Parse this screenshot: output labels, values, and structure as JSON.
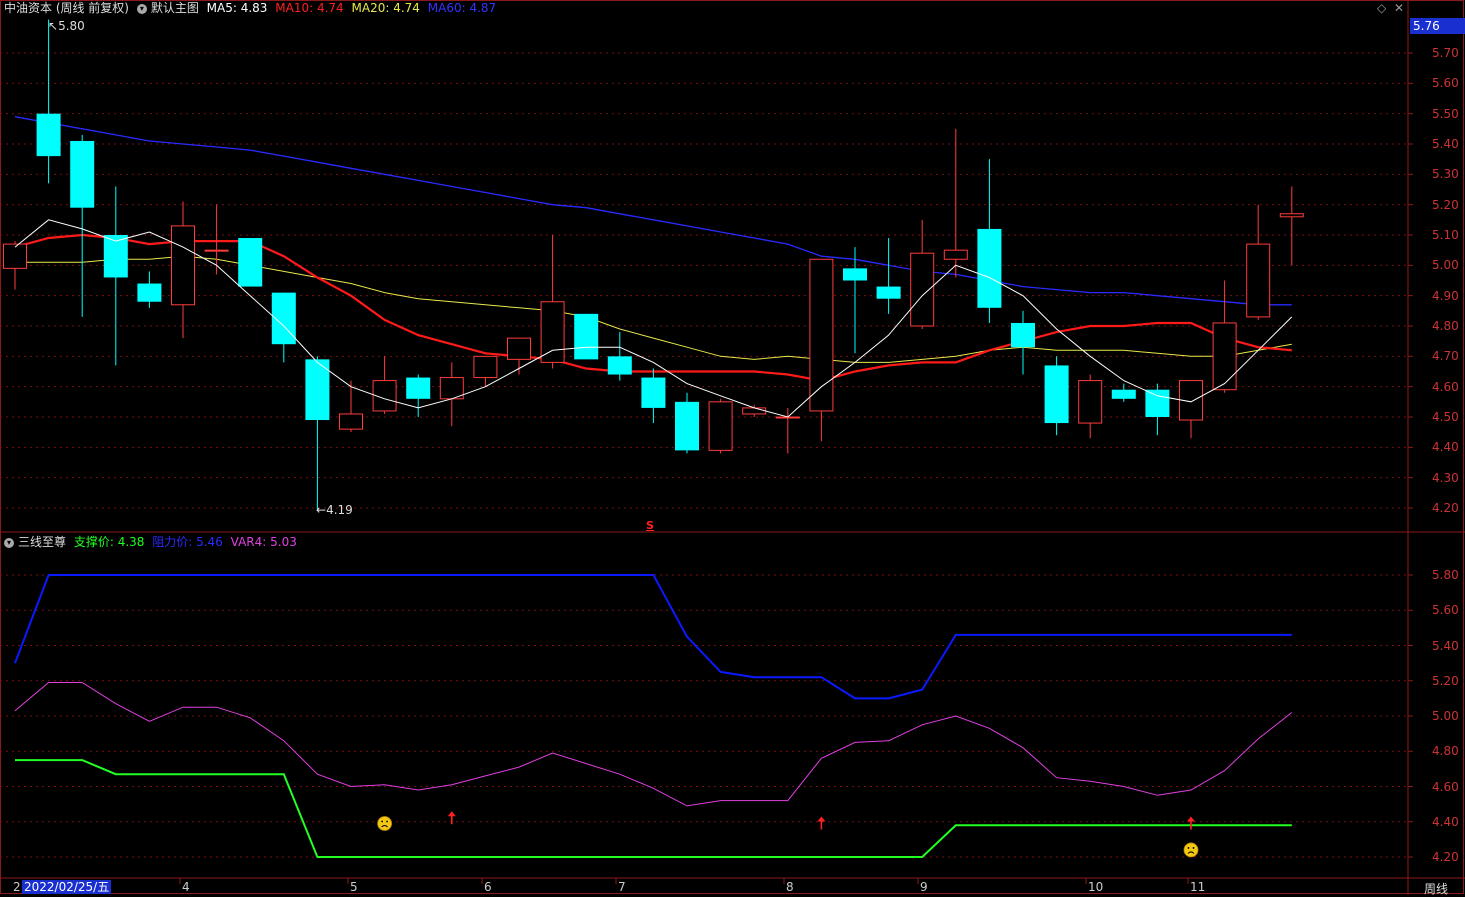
{
  "colors": {
    "border": "#8b1a1a",
    "grid": "#7a1010",
    "up": "#ff3b3b",
    "down": "#00ffff",
    "ma5": "#ffffff",
    "ma10": "#ff1a1a",
    "ma20": "#e8e84a",
    "ma60": "#2a2aff",
    "resist": "#0a1aff",
    "support": "#22ff22",
    "var4": "#e040e0",
    "axisText": "#cc3333"
  },
  "header": {
    "stock": "中油资本 (周线 前复权)",
    "main_name": "默认主图",
    "ma5": "MA5: 4.83",
    "ma10": "MA10: 4.74",
    "ma20": "MA20: 4.74",
    "ma60": "MA60: 4.87"
  },
  "indicator": {
    "name": "三线至尊",
    "support": "支撑价: 4.38",
    "resist": "阻力价: 5.46",
    "var4": "VAR4: 5.03"
  },
  "price_box": "5.76",
  "annotations": {
    "high": "5.80",
    "low": "4.19",
    "s_marker": "S"
  },
  "period_label": "周线",
  "x_labels": {
    "first_partial": "2",
    "date": "2022/02/25/五",
    "months": [
      "4",
      "5",
      "6",
      "7",
      "8",
      "9",
      "10",
      "11"
    ]
  },
  "chart_data": [
    {
      "type": "candlestick",
      "title": "中油资本 (周线 前复权)",
      "ylim": [
        4.15,
        5.8
      ],
      "yticks": [
        "5.70",
        "5.60",
        "5.50",
        "5.40",
        "5.30",
        "5.20",
        "5.10",
        "5.00",
        "4.90",
        "4.80",
        "4.70",
        "4.60",
        "4.50",
        "4.40",
        "4.30",
        "4.20"
      ],
      "ytick_values": [
        5.7,
        5.6,
        5.5,
        5.4,
        5.3,
        5.2,
        5.1,
        5.0,
        4.9,
        4.8,
        4.7,
        4.6,
        4.5,
        4.4,
        4.3,
        4.2
      ],
      "candles": [
        {
          "o": 4.99,
          "h": 5.08,
          "l": 4.92,
          "c": 5.07
        },
        {
          "o": 5.5,
          "h": 5.81,
          "l": 5.27,
          "c": 5.36
        },
        {
          "o": 5.41,
          "h": 5.43,
          "l": 4.83,
          "c": 5.19
        },
        {
          "o": 5.1,
          "h": 5.26,
          "l": 4.67,
          "c": 4.96
        },
        {
          "o": 4.94,
          "h": 4.98,
          "l": 4.86,
          "c": 4.88
        },
        {
          "o": 4.87,
          "h": 5.21,
          "l": 4.76,
          "c": 5.13
        },
        {
          "o": 5.05,
          "h": 5.2,
          "l": 4.97,
          "c": 5.05
        },
        {
          "o": 5.09,
          "h": 5.09,
          "l": 4.93,
          "c": 4.93
        },
        {
          "o": 4.91,
          "h": 4.91,
          "l": 4.68,
          "c": 4.74
        },
        {
          "o": 4.69,
          "h": 4.7,
          "l": 4.19,
          "c": 4.49
        },
        {
          "o": 4.46,
          "h": 4.62,
          "l": 4.45,
          "c": 4.51
        },
        {
          "o": 4.52,
          "h": 4.7,
          "l": 4.51,
          "c": 4.62
        },
        {
          "o": 4.63,
          "h": 4.64,
          "l": 4.5,
          "c": 4.56
        },
        {
          "o": 4.56,
          "h": 4.68,
          "l": 4.47,
          "c": 4.63
        },
        {
          "o": 4.63,
          "h": 4.7,
          "l": 4.6,
          "c": 4.7
        },
        {
          "o": 4.69,
          "h": 4.73,
          "l": 4.64,
          "c": 4.76
        },
        {
          "o": 4.68,
          "h": 5.1,
          "l": 4.66,
          "c": 4.88
        },
        {
          "o": 4.84,
          "h": 4.84,
          "l": 4.69,
          "c": 4.69
        },
        {
          "o": 4.7,
          "h": 4.78,
          "l": 4.62,
          "c": 4.64
        },
        {
          "o": 4.63,
          "h": 4.66,
          "l": 4.48,
          "c": 4.53
        },
        {
          "o": 4.55,
          "h": 4.58,
          "l": 4.38,
          "c": 4.39
        },
        {
          "o": 4.39,
          "h": 4.56,
          "l": 4.38,
          "c": 4.55
        },
        {
          "o": 4.51,
          "h": 4.54,
          "l": 4.5,
          "c": 4.53
        },
        {
          "o": 4.5,
          "h": 4.53,
          "l": 4.38,
          "c": 4.5
        },
        {
          "o": 4.52,
          "h": 5.02,
          "l": 4.42,
          "c": 5.02
        },
        {
          "o": 4.99,
          "h": 5.06,
          "l": 4.71,
          "c": 4.95
        },
        {
          "o": 4.93,
          "h": 5.09,
          "l": 4.84,
          "c": 4.89
        },
        {
          "o": 4.8,
          "h": 5.15,
          "l": 4.79,
          "c": 5.04
        },
        {
          "o": 5.02,
          "h": 5.45,
          "l": 4.96,
          "c": 5.05
        },
        {
          "o": 5.12,
          "h": 5.35,
          "l": 4.81,
          "c": 4.86
        },
        {
          "o": 4.81,
          "h": 4.85,
          "l": 4.64,
          "c": 4.73
        },
        {
          "o": 4.67,
          "h": 4.7,
          "l": 4.44,
          "c": 4.48
        },
        {
          "o": 4.48,
          "h": 4.64,
          "l": 4.43,
          "c": 4.62
        },
        {
          "o": 4.59,
          "h": 4.61,
          "l": 4.55,
          "c": 4.56
        },
        {
          "o": 4.59,
          "h": 4.61,
          "l": 4.44,
          "c": 4.5
        },
        {
          "o": 4.49,
          "h": 4.62,
          "l": 4.43,
          "c": 4.62
        },
        {
          "o": 4.59,
          "h": 4.95,
          "l": 4.58,
          "c": 4.81
        },
        {
          "o": 4.83,
          "h": 5.2,
          "l": 4.82,
          "c": 5.07
        },
        {
          "o": 5.16,
          "h": 5.26,
          "l": 5.0,
          "c": 5.17
        }
      ],
      "ma5": [
        5.06,
        5.15,
        5.12,
        5.08,
        5.11,
        5.06,
        5.0,
        4.9,
        4.8,
        4.68,
        4.6,
        4.56,
        4.53,
        4.56,
        4.6,
        4.66,
        4.72,
        4.73,
        4.73,
        4.68,
        4.61,
        4.57,
        4.53,
        4.5,
        4.6,
        4.68,
        4.77,
        4.9,
        5.0,
        4.96,
        4.9,
        4.79,
        4.7,
        4.62,
        4.57,
        4.55,
        4.61,
        4.72,
        4.83
      ],
      "ma10": [
        5.06,
        5.09,
        5.1,
        5.09,
        5.07,
        5.08,
        5.08,
        5.08,
        5.03,
        4.96,
        4.9,
        4.82,
        4.77,
        4.74,
        4.71,
        4.7,
        4.69,
        4.66,
        4.65,
        4.65,
        4.65,
        4.65,
        4.65,
        4.64,
        4.62,
        4.65,
        4.67,
        4.68,
        4.68,
        4.72,
        4.75,
        4.78,
        4.8,
        4.8,
        4.81,
        4.81,
        4.76,
        4.73,
        4.72
      ],
      "ma20": [
        5.01,
        5.01,
        5.01,
        5.02,
        5.02,
        5.03,
        5.02,
        5.0,
        4.98,
        4.96,
        4.94,
        4.91,
        4.89,
        4.88,
        4.87,
        4.86,
        4.85,
        4.83,
        4.79,
        4.76,
        4.73,
        4.7,
        4.69,
        4.7,
        4.69,
        4.68,
        4.68,
        4.69,
        4.7,
        4.72,
        4.73,
        4.72,
        4.72,
        4.72,
        4.71,
        4.7,
        4.7,
        4.72,
        4.74
      ],
      "ma60": [
        5.49,
        5.47,
        5.45,
        5.43,
        5.41,
        5.4,
        5.39,
        5.38,
        5.36,
        5.34,
        5.32,
        5.3,
        5.28,
        5.26,
        5.24,
        5.22,
        5.2,
        5.19,
        5.17,
        5.15,
        5.13,
        5.11,
        5.09,
        5.07,
        5.03,
        5.02,
        5.0,
        4.98,
        4.97,
        4.95,
        4.93,
        4.92,
        4.91,
        4.91,
        4.9,
        4.89,
        4.88,
        4.87,
        4.87
      ]
    },
    {
      "type": "line",
      "title": "三线至尊",
      "ylim": [
        4.15,
        5.98
      ],
      "yticks": [
        "5.80",
        "5.60",
        "5.40",
        "5.20",
        "5.00",
        "4.80",
        "4.60",
        "4.40",
        "4.20"
      ],
      "ytick_values": [
        5.8,
        5.6,
        5.4,
        5.2,
        5.0,
        4.8,
        4.6,
        4.4,
        4.2
      ],
      "series": [
        {
          "name": "阻力价",
          "values": [
            5.3,
            5.8,
            5.8,
            5.8,
            5.8,
            5.8,
            5.8,
            5.8,
            5.8,
            5.8,
            5.8,
            5.8,
            5.8,
            5.8,
            5.8,
            5.8,
            5.8,
            5.8,
            5.8,
            5.8,
            5.45,
            5.25,
            5.22,
            5.22,
            5.22,
            5.1,
            5.1,
            5.15,
            5.46,
            5.46,
            5.46,
            5.46,
            5.46,
            5.46,
            5.46,
            5.46,
            5.46,
            5.46,
            5.46
          ]
        },
        {
          "name": "VAR4",
          "values": [
            5.03,
            5.19,
            5.19,
            5.07,
            4.97,
            5.05,
            5.05,
            4.99,
            4.86,
            4.67,
            4.6,
            4.61,
            4.58,
            4.61,
            4.66,
            4.71,
            4.79,
            4.73,
            4.67,
            4.59,
            4.49,
            4.52,
            4.52,
            4.52,
            4.76,
            4.85,
            4.86,
            4.95,
            5.0,
            4.93,
            4.82,
            4.65,
            4.63,
            4.6,
            4.55,
            4.58,
            4.69,
            4.87,
            5.02
          ]
        },
        {
          "name": "支撑价",
          "values": [
            4.75,
            4.75,
            4.75,
            4.67,
            4.67,
            4.67,
            4.67,
            4.67,
            4.67,
            4.2,
            4.2,
            4.2,
            4.2,
            4.2,
            4.2,
            4.2,
            4.2,
            4.2,
            4.2,
            4.2,
            4.2,
            4.2,
            4.2,
            4.2,
            4.2,
            4.2,
            4.2,
            4.2,
            4.38,
            4.38,
            4.38,
            4.38,
            4.38,
            4.38,
            4.38,
            4.38,
            4.38,
            4.38,
            4.38
          ]
        }
      ],
      "markers": [
        {
          "type": "sad-face",
          "index": 11,
          "value": 4.39
        },
        {
          "type": "up-arrow",
          "index": 13,
          "value": 4.42
        },
        {
          "type": "up-arrow",
          "index": 24,
          "value": 4.39
        },
        {
          "type": "up-arrow",
          "index": 35,
          "value": 4.39
        },
        {
          "type": "sad-face",
          "index": 35,
          "value": 4.24
        }
      ]
    }
  ]
}
